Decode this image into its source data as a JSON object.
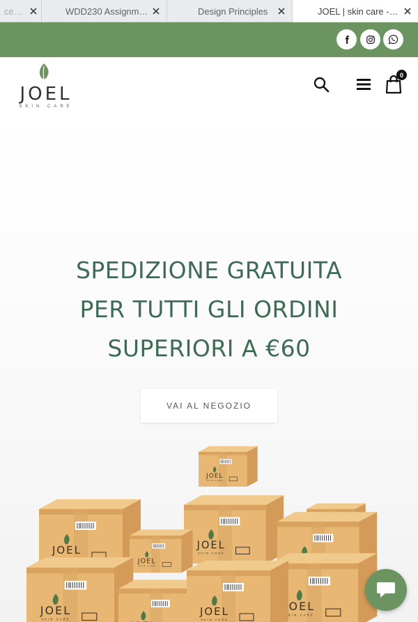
{
  "browser": {
    "tabs": [
      {
        "label": "ce…"
      },
      {
        "label": "WDD230 Assignme..."
      },
      {
        "label": "Design Principles"
      },
      {
        "label": "JOEL | skin care - c...",
        "active": true
      }
    ]
  },
  "social": {
    "icons": [
      "facebook-icon",
      "instagram-icon",
      "whatsapp-icon"
    ]
  },
  "header": {
    "logo_word": "JOEL",
    "logo_subtitle": "SKIN CARE",
    "cart_count": "0"
  },
  "hero": {
    "headline_lines": [
      "SPEDIZIONE GRATUITA",
      "PER TUTTI GLI ORDINI",
      "SUPERIORI A €60"
    ],
    "cta_label": "VAI AL NEGOZIO",
    "box_brand": "JOEL",
    "box_sub": "SKIN CARE"
  },
  "colors": {
    "brand_green": "#6b9460",
    "headline_green": "#3f6b56",
    "box_tan": "#e8b774"
  }
}
